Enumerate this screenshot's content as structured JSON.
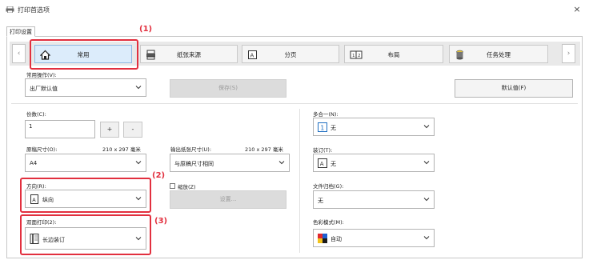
{
  "window": {
    "title": "打印首选项",
    "close_label": "×"
  },
  "tab": {
    "label": "打印设置"
  },
  "categories": [
    {
      "label": "常用",
      "icon": "home-icon"
    },
    {
      "label": "纸张来源",
      "icon": "paper-tray-icon"
    },
    {
      "label": "分页",
      "icon": "page-icon"
    },
    {
      "label": "布局",
      "icon": "layout-icon"
    },
    {
      "label": "任务处理",
      "icon": "job-handling-icon"
    }
  ],
  "nav": {
    "prev": "‹",
    "next": "›"
  },
  "callouts": {
    "c1": "(1)",
    "c2": "(2)",
    "c3": "(3)"
  },
  "favorites": {
    "label": "常用操作(V):",
    "value": "出厂默认值",
    "save_button": "保存(S)",
    "default_button": "默认值(F)"
  },
  "copies": {
    "label": "份数(C):",
    "value": "1",
    "plus": "+",
    "minus": "-"
  },
  "original_size": {
    "label": "原稿尺寸(O):",
    "dimensions": "210 x 297 毫米",
    "value": "A4"
  },
  "output_size": {
    "label": "输出纸张尺寸(U):",
    "dimensions": "210 x 297 毫米",
    "value": "与原稿尺寸相同"
  },
  "orientation": {
    "label": "方向(R):",
    "value": "纵向"
  },
  "zoom": {
    "checkbox_label": "缩放(Z)",
    "settings_button": "设置..."
  },
  "duplex": {
    "label": "双面打印(2):",
    "value": "长边装订"
  },
  "n_up": {
    "label": "多合一(N):",
    "value": "无"
  },
  "stapling": {
    "label": "装订(T):",
    "value": "无"
  },
  "filing": {
    "label": "文件归档(G):",
    "value": "无"
  },
  "color_mode": {
    "label": "色彩模式(M):",
    "value": "自动"
  }
}
